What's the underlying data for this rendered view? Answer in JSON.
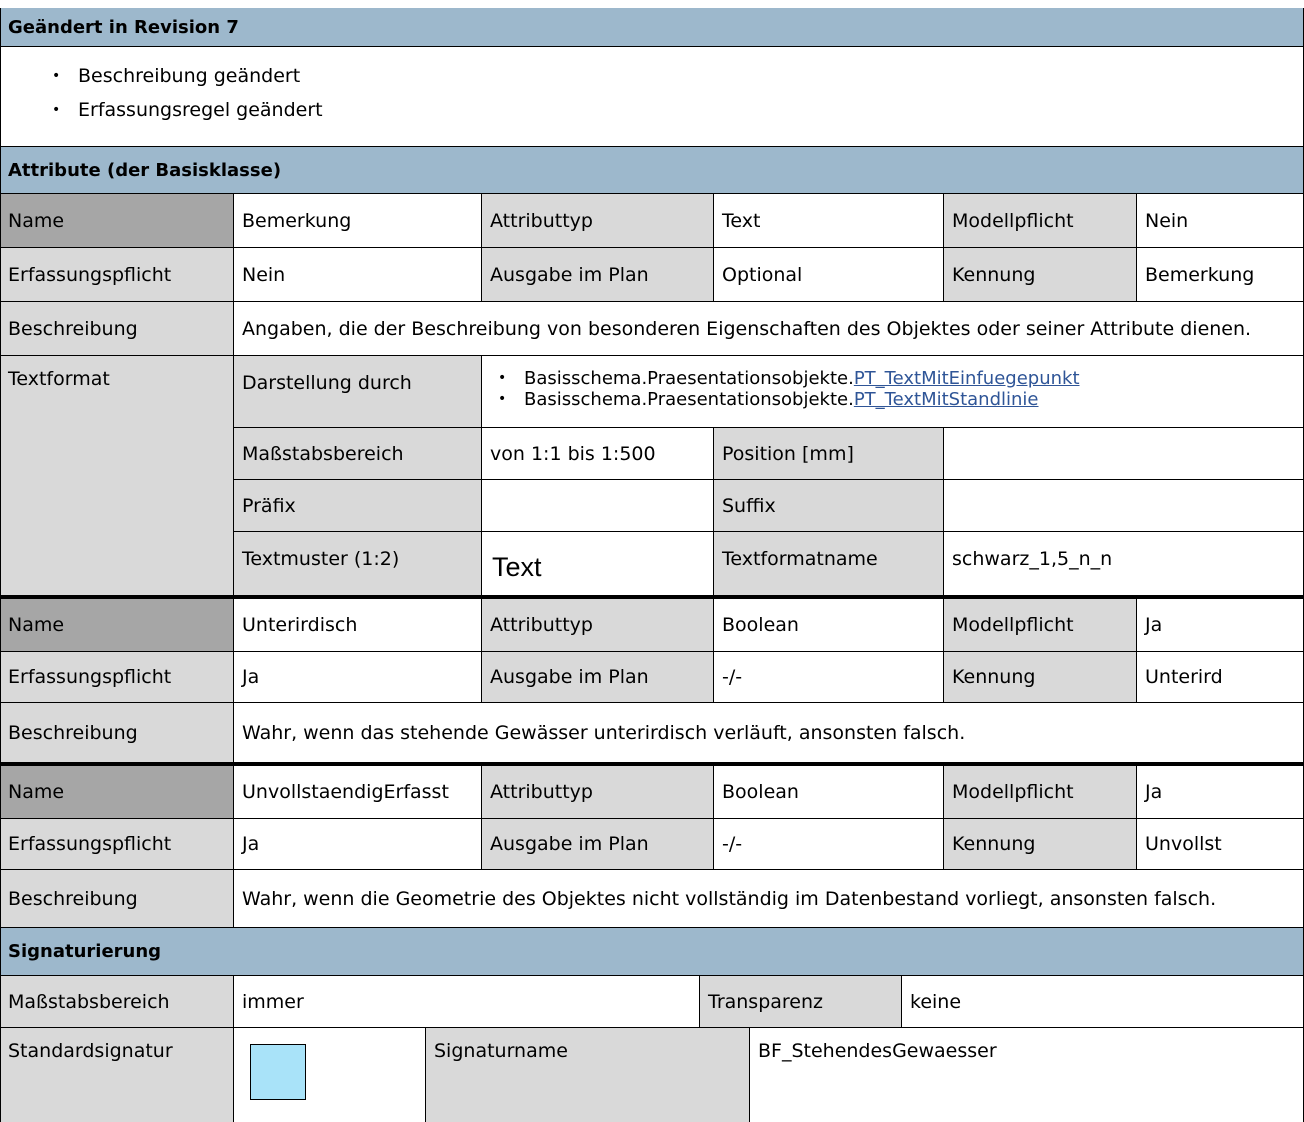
{
  "revision": {
    "heading": "Geändert in Revision 7",
    "changes": [
      "Beschreibung geändert",
      "Erfassungsregel geändert"
    ]
  },
  "attributes": {
    "heading": "Attribute (der Basisklasse)",
    "labels": {
      "name": "Name",
      "attributtyp": "Attributtyp",
      "modellpflicht": "Modellpflicht",
      "erfassungspflicht": "Erfassungspflicht",
      "ausgabe": "Ausgabe im Plan",
      "kennung": "Kennung",
      "beschreibung": "Beschreibung"
    },
    "items": [
      {
        "name": "Bemerkung",
        "attributtyp": "Text",
        "modellpflicht": "Nein",
        "erfassungspflicht": "Nein",
        "ausgabe": "Optional",
        "kennung": "Bemerkung",
        "beschreibung": "Angaben, die der Beschreibung von besonderen Eigenschaften des Objektes oder seiner Attribute dienen."
      },
      {
        "name": "Unterirdisch",
        "attributtyp": "Boolean",
        "modellpflicht": "Ja",
        "erfassungspflicht": "Ja",
        "ausgabe": "-/-",
        "kennung": "Unterird",
        "beschreibung": "Wahr, wenn das stehende Gewässer unterirdisch verläuft, ansonsten falsch."
      },
      {
        "name": "UnvollstaendigErfasst",
        "attributtyp": "Boolean",
        "modellpflicht": "Ja",
        "erfassungspflicht": "Ja",
        "ausgabe": "-/-",
        "kennung": "Unvollst",
        "beschreibung": "Wahr, wenn die Geometrie des Objektes nicht vollständig im Datenbestand vorliegt, ansonsten falsch."
      }
    ],
    "textformat": {
      "label": "Textformat",
      "darstellung_label": "Darstellung durch",
      "darstellung_prefix": "Basisschema.Praesentationsobjekte.",
      "links": [
        "PT_TextMitEinfuegepunkt",
        "PT_TextMitStandlinie"
      ],
      "massstab_label": "Maßstabsbereich",
      "massstab_value": "von 1:1 bis 1:500",
      "position_label": "Position [mm]",
      "position_value": "",
      "praefix_label": "Präfix",
      "praefix_value": "",
      "suffix_label": "Suffix",
      "suffix_value": "",
      "textmuster_label": "Textmuster (1:2)",
      "textmuster_value": "Text",
      "textformatname_label": "Textformatname",
      "textformatname_value": "schwarz_1,5_n_n"
    }
  },
  "signaturierung": {
    "heading": "Signaturierung",
    "massstab_label": "Maßstabsbereich",
    "massstab_value": "immer",
    "transparenz_label": "Transparenz",
    "transparenz_value": "keine",
    "standardsignatur_label": "Standardsignatur",
    "swatch_color": "#a9e3f9",
    "signaturname_label": "Signaturname",
    "signaturname_value": "BF_StehendesGewaesser"
  },
  "colors": {
    "header": "#9db8cc",
    "label_gray": "#d9d9d9",
    "name_gray": "#a6a6a6",
    "link": "#2f5597"
  }
}
